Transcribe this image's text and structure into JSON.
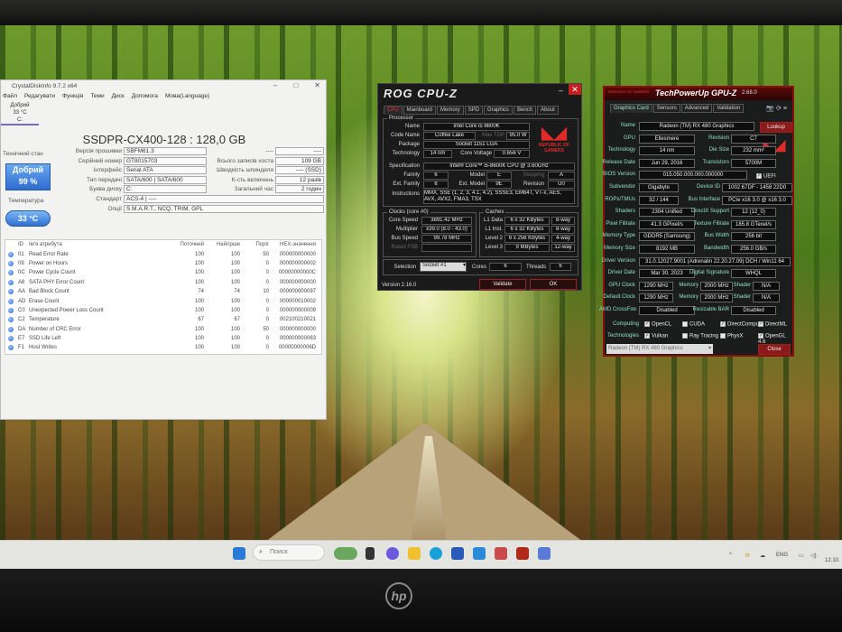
{
  "crystaldiskinfo": {
    "title": "CrystalDiskInfo 9.7.2 x64",
    "menu": [
      "Файл",
      "Редагувати",
      "Функція",
      "Теми",
      "Диск",
      "Допомога",
      "Мова(Language)"
    ],
    "disk_tab": {
      "status": "Добрий",
      "temp": "33 °C",
      "letter": "C:"
    },
    "model": "SSDPR-CX400-128 : 128,0 GB",
    "health_label": "Технічний стан",
    "health_status": "Добрий",
    "health_percent": "99 %",
    "temp_label": "Температура",
    "temp_value": "33 °C",
    "left_fields": [
      {
        "label": "Версія прошивки",
        "value": "SBFM61.3"
      },
      {
        "label": "Серійний номер",
        "value": "GT8015703"
      },
      {
        "label": "Інтерфейс",
        "value": "Serial ATA"
      },
      {
        "label": "Тип передачі",
        "value": "SATA/600 | SATA/600"
      },
      {
        "label": "Буква диску",
        "value": "C:"
      },
      {
        "label": "Стандарт",
        "value": "ACS-4 | ----"
      },
      {
        "label": "Опції",
        "value": "S.M.A.R.T., NCQ, TRIM, GPL"
      }
    ],
    "right_fields": [
      {
        "label": "----",
        "value": "----"
      },
      {
        "label": "Всього записів хоста",
        "value": "109 GB"
      },
      {
        "label": "Швидкість шпинделя",
        "value": "---- (SSD)"
      },
      {
        "label": "К-сть включень",
        "value": "12 разів"
      },
      {
        "label": "Загальний час",
        "value": "2 годин"
      }
    ],
    "smart_headers": [
      "ID",
      "Ім'я атрибута",
      "Поточний",
      "Найгірше",
      "Поріг",
      "HEX-значення"
    ],
    "smart_rows": [
      [
        "01",
        "Read Error Rate",
        "100",
        "100",
        "50",
        "000000000000"
      ],
      [
        "09",
        "Power on Hours",
        "100",
        "100",
        "0",
        "000000000002"
      ],
      [
        "0C",
        "Power Cycle Count",
        "100",
        "100",
        "0",
        "00000000000C"
      ],
      [
        "A8",
        "SATA PHY Error Count",
        "100",
        "100",
        "0",
        "000000000000"
      ],
      [
        "AA",
        "Bad Block Count",
        "74",
        "74",
        "10",
        "000000000097"
      ],
      [
        "AD",
        "Erase Count",
        "100",
        "100",
        "0",
        "000000010002"
      ],
      [
        "C0",
        "Unexpected Power Loss Count",
        "100",
        "100",
        "0",
        "000000000009"
      ],
      [
        "C2",
        "Temperature",
        "67",
        "67",
        "0",
        "002100210021"
      ],
      [
        "DA",
        "Number of CRC Error",
        "100",
        "100",
        "50",
        "000000000000"
      ],
      [
        "E7",
        "SSD Life Left",
        "100",
        "100",
        "0",
        "000000000063"
      ],
      [
        "F1",
        "Host Writes",
        "100",
        "100",
        "0",
        "00000000006D"
      ]
    ]
  },
  "cpuz": {
    "title": "ROG CPU-Z",
    "tabs": [
      "CPU",
      "Mainboard",
      "Memory",
      "SPD",
      "Graphics",
      "Bench",
      "About"
    ],
    "processor_caption": "Processor",
    "name_label": "Name",
    "name": "Intel Core i5 8600K",
    "codename_label": "Code Name",
    "codename": "Coffee Lake",
    "maxtdp_label": "Max TDP",
    "maxtdp": "95.0 W",
    "package_label": "Package",
    "package": "Socket 1151 LGA",
    "tech_label": "Technology",
    "tech": "14 nm",
    "voltage_label": "Core Voltage",
    "voltage": "0.656 V",
    "spec_label": "Specification",
    "spec": "Intel® Core™ i5-8600K CPU @ 3.60GHz",
    "family_label": "Family",
    "family": "6",
    "model_label": "Model",
    "model": "E",
    "stepping_label": "Stepping",
    "stepping": "A",
    "extfamily_label": "Ext. Family",
    "extfamily": "6",
    "extmodel_label": "Ext. Model",
    "extmodel": "9E",
    "revision_label": "Revision",
    "revision": "U0",
    "instr_label": "Instructions",
    "instr": "MMX, SSE (1, 2, 3, 4.1, 4.2), SSSE3, EM64T, VT-x, AES, AVX, AVX2, FMA3, TSX",
    "logo_text": "REPUBLIC OF GAMERS",
    "clocks_caption": "Clocks (core #0)",
    "corespeed_label": "Core Speed",
    "corespeed": "3891.42 MHz",
    "multiplier_label": "Multiplier",
    "multiplier": "x39.0 (8.0 - 43.0)",
    "busspeed_label": "Bus Speed",
    "busspeed": "99.78 MHz",
    "ratedfsb_label": "Rated FSB",
    "ratedfsb": "",
    "caches_caption": "Caches",
    "caches": [
      [
        "L1 Data",
        "6 x 32 KBytes",
        "8-way"
      ],
      [
        "L1 Inst.",
        "6 x 32 KBytes",
        "8-way"
      ],
      [
        "Level 2",
        "6 x 256 KBytes",
        "4-way"
      ],
      [
        "Level 3",
        "9 MBytes",
        "12-way"
      ]
    ],
    "selection_label": "Selection",
    "selection": "Socket #1",
    "cores_label": "Cores",
    "cores": "6",
    "threads_label": "Threads",
    "threads": "6",
    "version": "Version 2.16.0",
    "validate": "Validate",
    "ok": "OK"
  },
  "gpuz": {
    "title": "TechPowerUp GPU-Z",
    "version": "2.68.0",
    "brand": "REPUBLIC OF GAMERS",
    "tabs": [
      "Graphics Card",
      "Sensors",
      "Advanced",
      "Validation"
    ],
    "lookup": "Lookup",
    "rows": [
      [
        [
          "Name",
          "Radeon (TM) RX 480 Graphics"
        ]
      ],
      [
        [
          "GPU",
          "Ellesmere"
        ],
        [
          "Revision",
          "C7"
        ]
      ],
      [
        [
          "Technology",
          "14 nm"
        ],
        [
          "Die Size",
          "232 mm²"
        ]
      ],
      [
        [
          "Release Date",
          "Jun 29, 2016"
        ],
        [
          "Transistors",
          "5700M"
        ]
      ],
      [
        [
          "BIOS Version",
          "015.050.000.000.000000"
        ]
      ],
      [
        [
          "Subvendor",
          "Gigabyte"
        ],
        [
          "Device ID",
          "1002 67DF - 1458 22D0"
        ]
      ],
      [
        [
          "ROPs/TMUs",
          "32 / 144"
        ],
        [
          "Bus Interface",
          "PCIe x16 3.0 @ x16 3.0"
        ]
      ],
      [
        [
          "Shaders",
          "2304 Unified"
        ],
        [
          "DirectX Support",
          "12 (12_0)"
        ]
      ],
      [
        [
          "Pixel Fillrate",
          "41.3 GPixel/s"
        ],
        [
          "Texture Fillrate",
          "185.8 GTexel/s"
        ]
      ],
      [
        [
          "Memory Type",
          "GDDR5 (Samsung)"
        ],
        [
          "Bus Width",
          "256 bit"
        ]
      ],
      [
        [
          "Memory Size",
          "8192 MB"
        ],
        [
          "Bandwidth",
          "256.0 GB/s"
        ]
      ],
      [
        [
          "Driver Version",
          "31.0.12027.9001 (Adrenalin 22.20.27.09) DCH / Win11 64"
        ]
      ],
      [
        [
          "Driver Date",
          "Mar 30, 2023"
        ],
        [
          "Digital Signature",
          "WHQL"
        ]
      ],
      [
        [
          "GPU Clock",
          "1290 MHz"
        ],
        [
          "Memory",
          "2000 MHz"
        ],
        [
          "Shader",
          "N/A"
        ]
      ],
      [
        [
          "Default Clock",
          "1290 MHz"
        ],
        [
          "Memory",
          "2000 MHz"
        ],
        [
          "Shader",
          "N/A"
        ]
      ],
      [
        [
          "AMD CrossFire",
          "Disabled"
        ],
        [
          "Resizable BAR",
          "Disabled"
        ]
      ]
    ],
    "uefi": "UEFI",
    "computing_label": "Computing",
    "computing": [
      [
        "OpenCL",
        true
      ],
      [
        "CUDA",
        false
      ],
      [
        "DirectCompute",
        true
      ],
      [
        "DirectML",
        true
      ]
    ],
    "tech_label": "Technologies",
    "technologies": [
      [
        "Vulkan",
        true
      ],
      [
        "Ray Tracing",
        false
      ],
      [
        "PhysX",
        false
      ],
      [
        "OpenGL 4.6",
        true
      ]
    ],
    "selected_gpu": "Radeon (TM) RX 480 Graphics",
    "close": "Close"
  },
  "taskbar": {
    "search": "Поиск",
    "lang": "ENG",
    "date": "12.10."
  },
  "monitor": {
    "brand": "hp"
  }
}
